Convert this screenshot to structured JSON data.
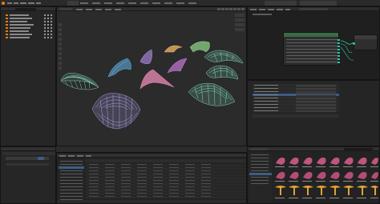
{
  "colors": {
    "app_bg": "#1d1d1d",
    "panel": "#282828",
    "header": "#303030",
    "viewport": "#2b2b2b",
    "select_blue": "#3d5d86",
    "node_header": "#3a6a45",
    "teal": "#2ec4a6"
  },
  "topbar": {
    "menu_items": [
      "",
      "",
      "",
      "",
      "",
      "",
      "",
      ""
    ],
    "workspace_tabs": [
      "",
      "",
      "",
      "",
      "",
      "",
      "",
      "",
      "",
      ""
    ]
  },
  "outliner": {
    "items": [
      "",
      "",
      "",
      "",
      "",
      "",
      "",
      "",
      "",
      "",
      "",
      ""
    ]
  },
  "viewport": {
    "objects": [
      {
        "name": "wire-shell-teal-left"
      },
      {
        "name": "wire-shell-purple-front"
      },
      {
        "name": "wire-wing-cyan"
      },
      {
        "name": "wire-leaf-violet"
      },
      {
        "name": "wire-crescent-orange"
      },
      {
        "name": "wire-wing-magenta"
      },
      {
        "name": "wire-wing-pink"
      },
      {
        "name": "wire-hat-green"
      },
      {
        "name": "wire-canopy-teal"
      },
      {
        "name": "wire-shell-teal-right"
      },
      {
        "name": "wire-shell-teal-top"
      }
    ]
  },
  "node_editor": {
    "title": "",
    "socket_rows": 8
  },
  "properties": {
    "rows": 9
  },
  "spreadsheet": {
    "columns": [
      "",
      "",
      "",
      "",
      "",
      "",
      "",
      ""
    ],
    "row_count": 11
  },
  "asset_browser": {
    "thumb_count": 24
  }
}
